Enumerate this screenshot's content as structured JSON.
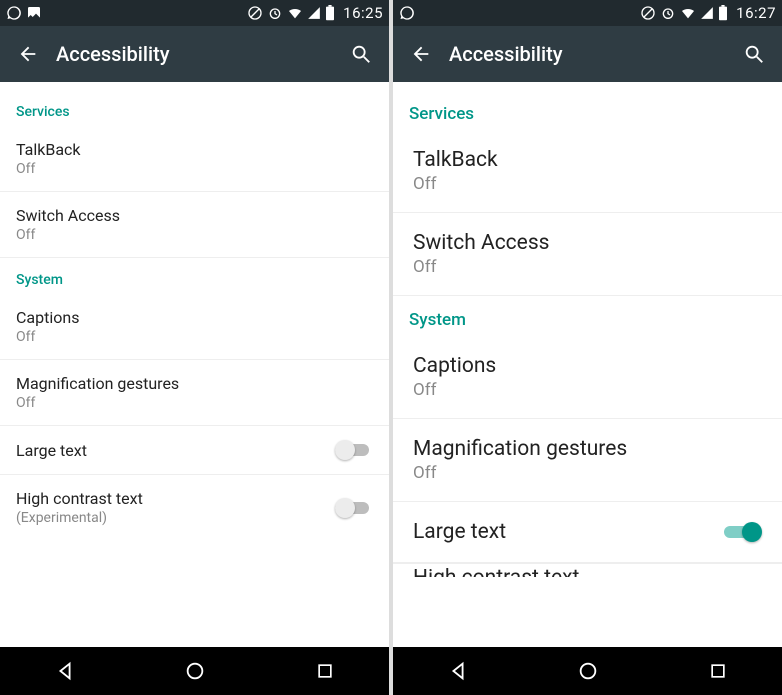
{
  "left": {
    "status": {
      "time": "16:25"
    },
    "appbar": {
      "title": "Accessibility"
    },
    "sections": [
      {
        "header": "Services",
        "items": [
          {
            "title": "TalkBack",
            "sub": "Off"
          },
          {
            "title": "Switch Access",
            "sub": "Off"
          }
        ]
      },
      {
        "header": "System",
        "items": [
          {
            "title": "Captions",
            "sub": "Off"
          },
          {
            "title": "Magnification gestures",
            "sub": "Off"
          },
          {
            "title": "Large text",
            "switch": false
          },
          {
            "title": "High contrast text",
            "sub": "(Experimental)",
            "switch": false
          }
        ]
      }
    ]
  },
  "right": {
    "status": {
      "time": "16:27"
    },
    "appbar": {
      "title": "Accessibility"
    },
    "sections": [
      {
        "header": "Services",
        "items": [
          {
            "title": "TalkBack",
            "sub": "Off"
          },
          {
            "title": "Switch Access",
            "sub": "Off"
          }
        ]
      },
      {
        "header": "System",
        "items": [
          {
            "title": "Captions",
            "sub": "Off"
          },
          {
            "title": "Magnification gestures",
            "sub": "Off"
          },
          {
            "title": "Large text",
            "switch": true
          }
        ]
      }
    ],
    "cutoff": "High contrast text"
  }
}
